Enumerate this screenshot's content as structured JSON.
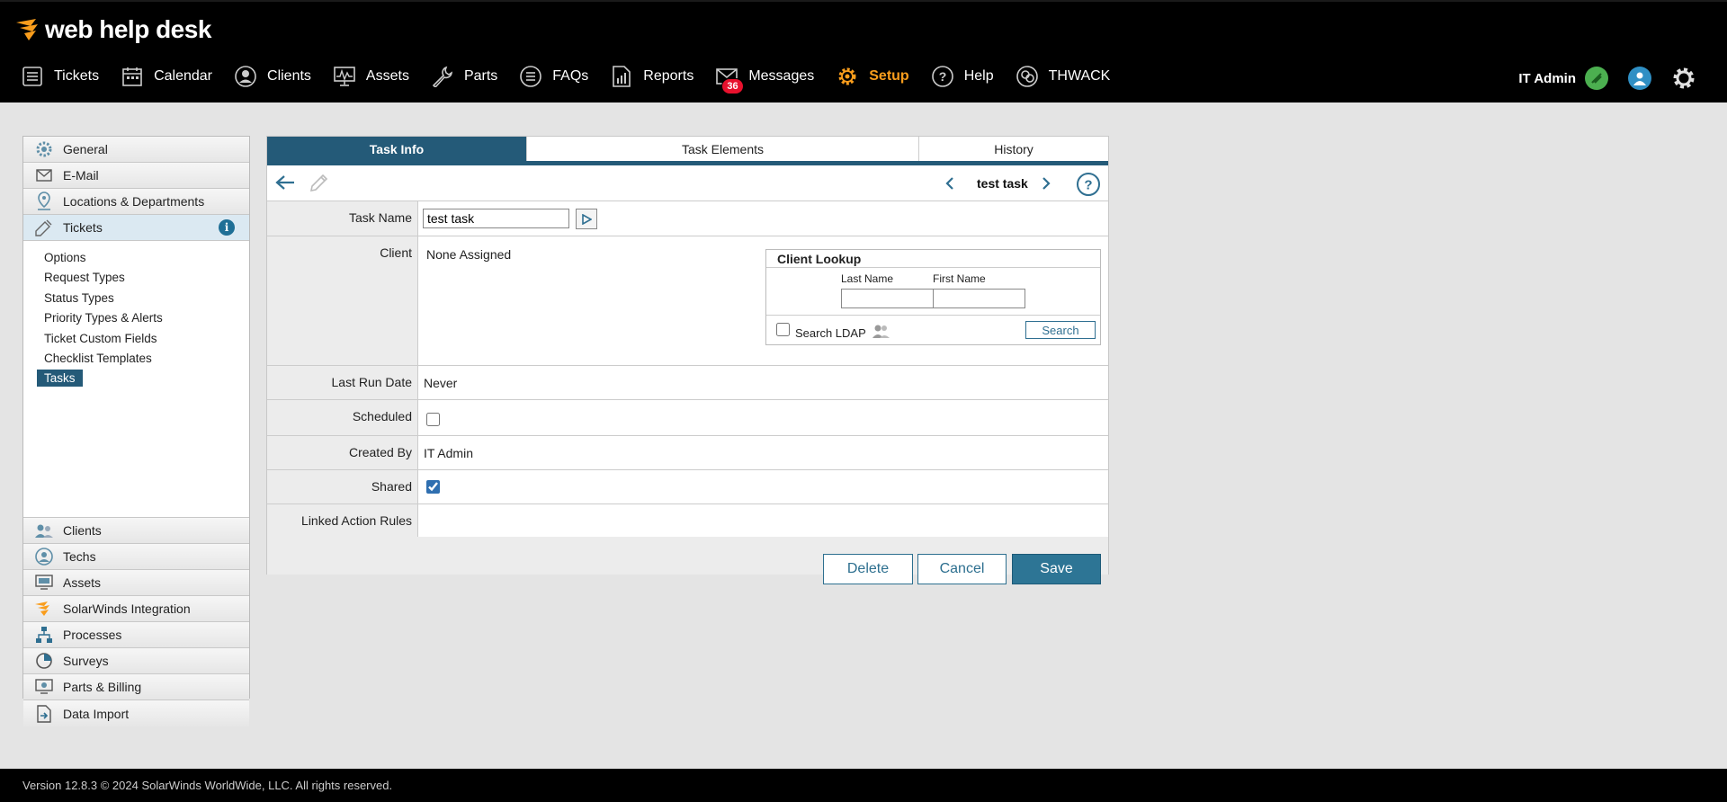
{
  "app": {
    "logo_text": "web help desk"
  },
  "nav": {
    "items": [
      {
        "label": "Tickets"
      },
      {
        "label": "Calendar"
      },
      {
        "label": "Clients"
      },
      {
        "label": "Assets"
      },
      {
        "label": "Parts"
      },
      {
        "label": "FAQs"
      },
      {
        "label": "Reports"
      },
      {
        "label": "Messages",
        "badge": "36"
      },
      {
        "label": "Setup"
      },
      {
        "label": "Help"
      },
      {
        "label": "THWACK"
      }
    ],
    "user": "IT Admin"
  },
  "sidebar": {
    "top_items": [
      {
        "label": "General"
      },
      {
        "label": "E-Mail"
      },
      {
        "label": "Locations & Departments"
      },
      {
        "label": "Tickets"
      }
    ],
    "ticket_sub": [
      "Options",
      "Request Types",
      "Status Types",
      "Priority Types & Alerts",
      "Ticket Custom Fields",
      "Checklist Templates",
      "Tasks"
    ],
    "bottom_items": [
      {
        "label": "Clients"
      },
      {
        "label": "Techs"
      },
      {
        "label": "Assets"
      },
      {
        "label": "SolarWinds Integration"
      },
      {
        "label": "Processes"
      },
      {
        "label": "Surveys"
      },
      {
        "label": "Parts & Billing"
      },
      {
        "label": "Data Import"
      }
    ]
  },
  "tabs": [
    "Task Info",
    "Task Elements",
    "History"
  ],
  "record_title": "test task",
  "form": {
    "task_name_label": "Task Name",
    "task_name_value": "test task",
    "client_label": "Client",
    "client_value": "None Assigned",
    "lookup": {
      "title": "Client Lookup",
      "last_name_label": "Last Name",
      "first_name_label": "First Name",
      "search_ldap_label": "Search LDAP",
      "search_button": "Search"
    },
    "last_run_label": "Last Run Date",
    "last_run_value": "Never",
    "scheduled_label": "Scheduled",
    "created_by_label": "Created By",
    "created_by_value": "IT Admin",
    "shared_label": "Shared",
    "linked_rules_label": "Linked Action Rules"
  },
  "buttons": {
    "delete": "Delete",
    "cancel": "Cancel",
    "save": "Save"
  },
  "footer": "Version 12.8.3 © 2024 SolarWinds WorldWide, LLC. All rights reserved.",
  "colors": {
    "accent": "#245a78",
    "setup_orange": "#f99d1c",
    "badge_red": "#e8112d"
  }
}
